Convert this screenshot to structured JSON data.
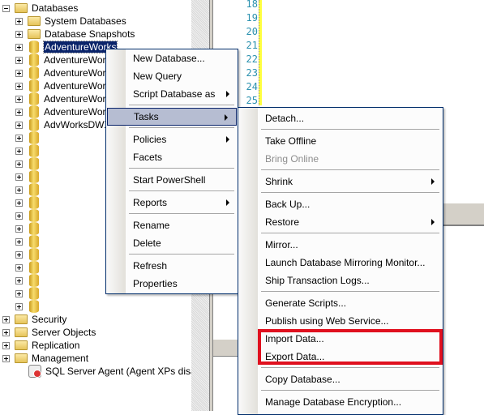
{
  "tree": {
    "root": {
      "label": "Databases",
      "icon": "folder-icon",
      "expanded": true
    },
    "children": [
      {
        "label": "System Databases",
        "icon": "folder-icon"
      },
      {
        "label": "Database Snapshots",
        "icon": "folder-icon"
      },
      {
        "label": "AdventureWorks",
        "icon": "database-icon",
        "selected": true
      },
      {
        "label": "AdventureWork",
        "icon": "database-icon"
      },
      {
        "label": "AdventureWork",
        "icon": "database-icon"
      },
      {
        "label": "AdventureWork",
        "icon": "database-icon"
      },
      {
        "label": "AdventureWork",
        "icon": "database-icon"
      },
      {
        "label": "AdventureWork",
        "icon": "database-icon"
      },
      {
        "label": "AdvWorksDWX",
        "icon": "database-icon"
      }
    ],
    "unlabeled_database_rows": 14,
    "server_nodes": [
      {
        "label": "Security",
        "icon": "folder-icon"
      },
      {
        "label": "Server Objects",
        "icon": "folder-icon"
      },
      {
        "label": "Replication",
        "icon": "folder-icon"
      },
      {
        "label": "Management",
        "icon": "folder-icon"
      }
    ],
    "agent": {
      "label": "SQL Server Agent (Agent XPs disabled)",
      "icon": "sql-agent-icon"
    }
  },
  "editor": {
    "line_numbers": [
      "18",
      "19",
      "20",
      "21",
      "22",
      "23",
      "24",
      "25"
    ],
    "line_number_color": "#2b91af"
  },
  "context_menu": {
    "items": [
      {
        "label": "New Database..."
      },
      {
        "label": "New Query"
      },
      {
        "label": "Script Database as",
        "submenu": true
      },
      {
        "label": "Tasks",
        "submenu": true,
        "highlighted": true
      },
      {
        "label": "Policies",
        "submenu": true
      },
      {
        "label": "Facets"
      },
      {
        "label": "Start PowerShell"
      },
      {
        "label": "Reports",
        "submenu": true
      },
      {
        "label": "Rename"
      },
      {
        "label": "Delete"
      },
      {
        "label": "Refresh"
      },
      {
        "label": "Properties"
      }
    ]
  },
  "tasks_submenu": {
    "items": [
      {
        "label": "Detach..."
      },
      {
        "label": "Take Offline"
      },
      {
        "label": "Bring Online",
        "disabled": true
      },
      {
        "label": "Shrink",
        "submenu": true
      },
      {
        "label": "Back Up..."
      },
      {
        "label": "Restore",
        "submenu": true
      },
      {
        "label": "Mirror..."
      },
      {
        "label": "Launch Database Mirroring Monitor..."
      },
      {
        "label": "Ship Transaction Logs..."
      },
      {
        "label": "Generate Scripts..."
      },
      {
        "label": "Publish using Web Service..."
      },
      {
        "label": "Import Data..."
      },
      {
        "label": "Export Data..."
      },
      {
        "label": "Copy Database..."
      },
      {
        "label": "Manage Database Encryption..."
      }
    ],
    "highlight_color": "#e0101e"
  }
}
